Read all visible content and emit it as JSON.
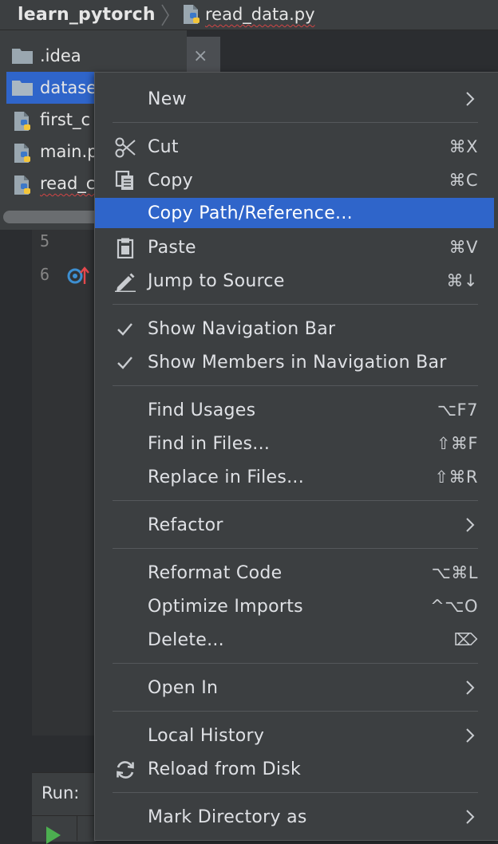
{
  "breadcrumb": {
    "project": "learn_pytorch",
    "file": "read_data.py"
  },
  "project_tree": {
    "items": [
      {
        "label": ".idea",
        "type": "folder"
      },
      {
        "label": "datase",
        "type": "folder"
      },
      {
        "label": "first_c",
        "type": "python"
      },
      {
        "label": "main.p",
        "type": "python"
      },
      {
        "label": "read_c",
        "type": "python"
      }
    ]
  },
  "tab": {
    "close_glyph": "×"
  },
  "editor": {
    "line_numbers": [
      "5",
      "6"
    ]
  },
  "run_panel": {
    "label": "Run:"
  },
  "context_menu": {
    "items": [
      {
        "label": "New",
        "shortcut": "",
        "submenu": true
      },
      {
        "label": "Cut",
        "shortcut": "⌘X",
        "icon": "scissors-icon"
      },
      {
        "label": "Copy",
        "shortcut": "⌘C",
        "icon": "copy-icon"
      },
      {
        "label": "Copy Path/Reference...",
        "shortcut": "",
        "highlighted": true
      },
      {
        "label": "Paste",
        "shortcut": "⌘V",
        "icon": "clipboard-icon"
      },
      {
        "label": "Jump to Source",
        "shortcut": "⌘↓",
        "icon": "pencil-icon"
      },
      {
        "label": "Show Navigation Bar",
        "shortcut": "",
        "checked": true
      },
      {
        "label": "Show Members in Navigation Bar",
        "shortcut": "",
        "checked": true
      },
      {
        "label": "Find Usages",
        "shortcut": "⌥F7"
      },
      {
        "label": "Find in Files...",
        "shortcut": "⇧⌘F"
      },
      {
        "label": "Replace in Files...",
        "shortcut": "⇧⌘R"
      },
      {
        "label": "Refactor",
        "shortcut": "",
        "submenu": true
      },
      {
        "label": "Reformat Code",
        "shortcut": "⌥⌘L"
      },
      {
        "label": "Optimize Imports",
        "shortcut": "^⌥O"
      },
      {
        "label": "Delete...",
        "shortcut": "⌦",
        "icon": "delete-key-icon"
      },
      {
        "label": "Open In",
        "shortcut": "",
        "submenu": true
      },
      {
        "label": "Local History",
        "shortcut": "",
        "submenu": true
      },
      {
        "label": "Reload from Disk",
        "shortcut": "",
        "icon": "reload-icon"
      },
      {
        "label": "Mark Directory as",
        "shortcut": "",
        "submenu": true
      }
    ]
  },
  "colors": {
    "selection": "#2f65ca",
    "menu_bg": "#3c3f41",
    "editor_bg": "#2b2d30",
    "error_underline": "#d24545"
  }
}
